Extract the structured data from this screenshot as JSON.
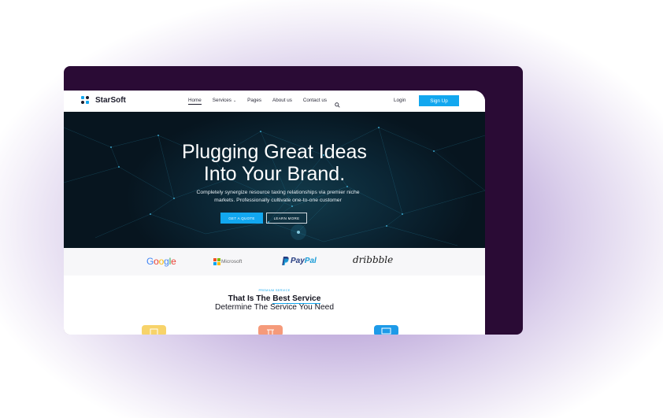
{
  "brand": {
    "name": "StarSoft",
    "accent": "#12a7ef",
    "background_dark": "#2a0b35"
  },
  "nav": {
    "items": [
      {
        "label": "Home",
        "active": true
      },
      {
        "label": "Services",
        "has_dropdown": true
      },
      {
        "label": "Pages"
      },
      {
        "label": "About us"
      },
      {
        "label": "Contact us"
      }
    ],
    "search_icon": "search-icon",
    "login_label": "Login",
    "signup_label": "Sign Up"
  },
  "hero": {
    "title_line1": "Plugging Great Ideas",
    "title_line2": "Into Your Brand.",
    "subtitle_line1": "Completely synergize resource taxing relationships via premier niche",
    "subtitle_line2": "markets. Professionally cultivate one-to-one customer",
    "cta_primary": "GET A QUOTE",
    "cta_secondary": "LEARN MORE"
  },
  "partners": {
    "google": "Google",
    "microsoft": "Microsoft",
    "paypal_a": "Pay",
    "paypal_b": "Pal",
    "dribbble": "dribbble"
  },
  "services": {
    "eyebrow": "PREMIUM SERVICE",
    "title_prefix": "That Is The ",
    "title_highlight": "Best Service",
    "subtitle": "Determine The Service You Need",
    "icon_colors": [
      "#f7d36a",
      "#f59a7a",
      "#1d9ae8"
    ]
  }
}
